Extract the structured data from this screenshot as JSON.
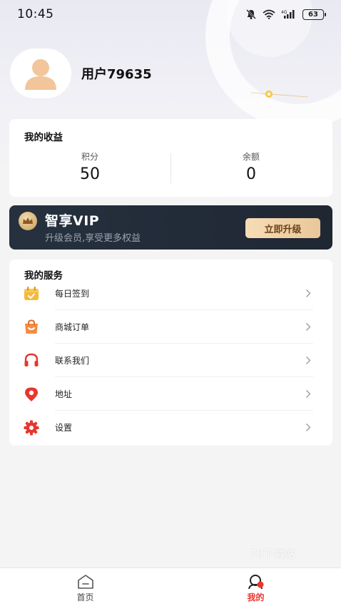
{
  "status_bar": {
    "time": "10:45",
    "battery": "63"
  },
  "profile": {
    "username": "用户79635"
  },
  "earnings": {
    "title": "我的收益",
    "points_label": "积分",
    "points_value": "50",
    "balance_label": "余额",
    "balance_value": "0"
  },
  "vip": {
    "title": "智享VIP",
    "subtitle": "升级会员,享受更多权益",
    "button_label": "立即升级"
  },
  "services": {
    "title": "我的服务",
    "items": [
      {
        "label": "每日签到",
        "icon": "calendar-check-icon"
      },
      {
        "label": "商城订单",
        "icon": "shopping-bag-icon"
      },
      {
        "label": "联系我们",
        "icon": "headset-icon"
      },
      {
        "label": "地址",
        "icon": "location-pin-icon"
      },
      {
        "label": "设置",
        "icon": "gear-icon"
      }
    ]
  },
  "watermark": "78下载站",
  "tabbar": {
    "home_label": "首页",
    "mine_label": "我的"
  },
  "colors": {
    "accent": "#e8362e",
    "vip_bg": "#26313f",
    "vip_button": "#f6dcb6"
  }
}
